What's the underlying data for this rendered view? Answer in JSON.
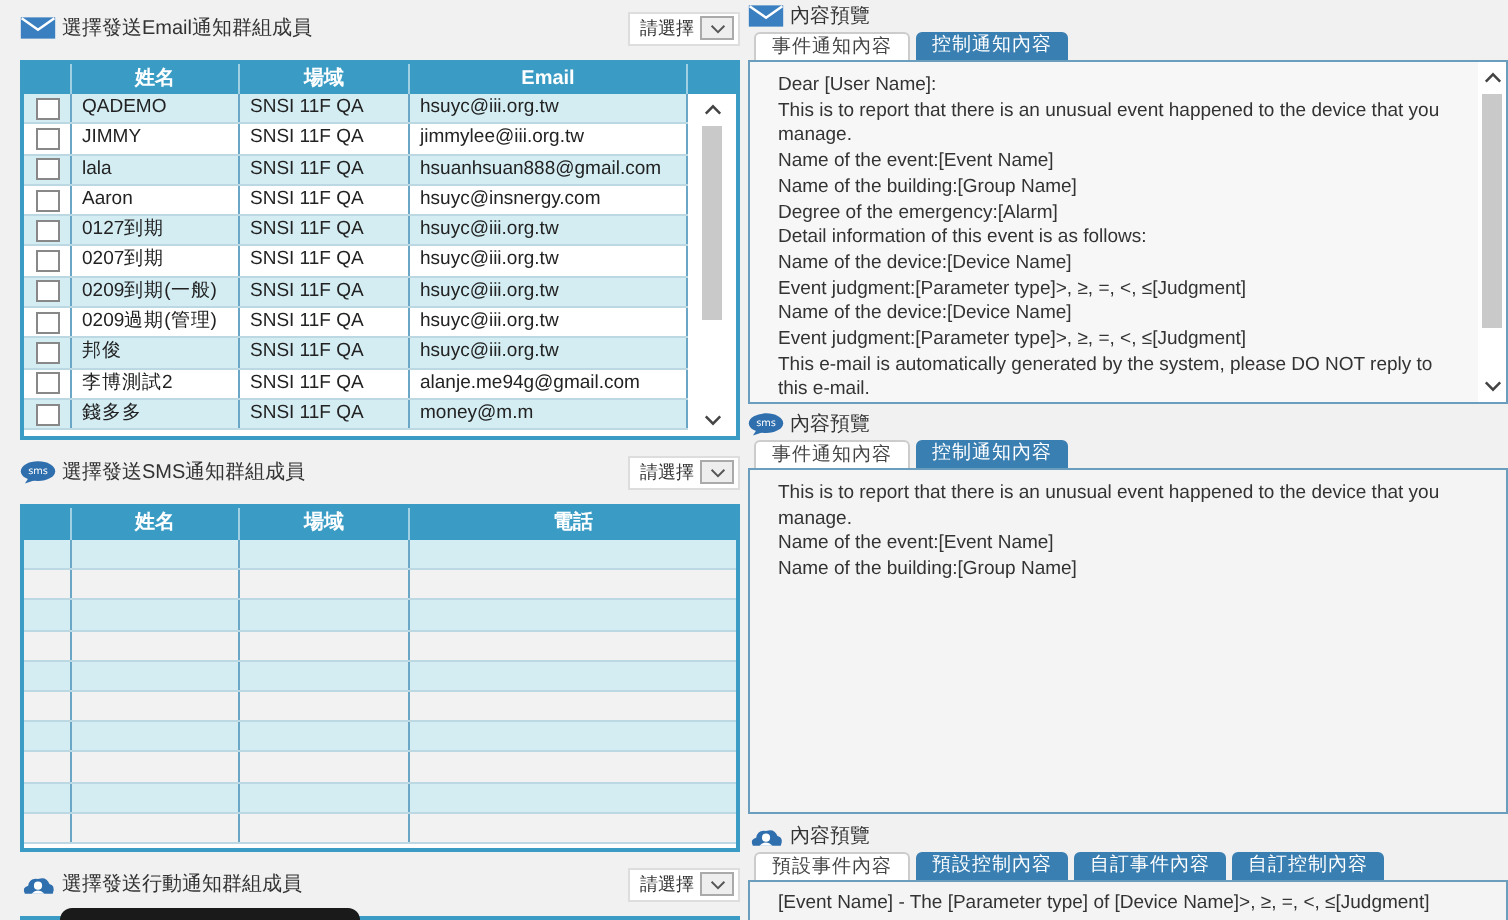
{
  "email_section": {
    "kind": "email",
    "title": "選擇發送Email通知群組成員",
    "select_label": "請選擇",
    "columns": [
      "姓名",
      "場域",
      "Email"
    ],
    "rows": [
      {
        "checked": false,
        "cells": [
          "QADEMO",
          "SNSI 11F QA",
          "hsuyc@iii.org.tw"
        ]
      },
      {
        "checked": false,
        "cells": [
          "JIMMY",
          "SNSI 11F QA",
          "jimmylee@iii.org.tw"
        ]
      },
      {
        "checked": false,
        "cells": [
          "lala",
          "SNSI 11F QA",
          "hsuanhsuan888@gmail.com"
        ]
      },
      {
        "checked": false,
        "cells": [
          "Aaron",
          "SNSI 11F QA",
          "hsuyc@insnergy.com"
        ]
      },
      {
        "checked": false,
        "cells": [
          "0127到期",
          "SNSI 11F QA",
          "hsuyc@iii.org.tw"
        ]
      },
      {
        "checked": false,
        "cells": [
          "0207到期",
          "SNSI 11F QA",
          "hsuyc@iii.org.tw"
        ]
      },
      {
        "checked": false,
        "cells": [
          "0209到期(一般)",
          "SNSI 11F QA",
          "hsuyc@iii.org.tw"
        ]
      },
      {
        "checked": false,
        "cells": [
          "0209過期(管理)",
          "SNSI 11F QA",
          "hsuyc@iii.org.tw"
        ]
      },
      {
        "checked": false,
        "cells": [
          "邦俊",
          "SNSI 11F QA",
          "hsuyc@iii.org.tw"
        ]
      },
      {
        "checked": false,
        "cells": [
          "李博測試2",
          "SNSI 11F QA",
          "alanje.me94g@gmail.com"
        ]
      },
      {
        "checked": false,
        "cells": [
          "錢多多",
          "SNSI 11F QA",
          "money@m.m"
        ]
      }
    ]
  },
  "sms_section": {
    "kind": "sms",
    "title": "選擇發送SMS通知群組成員",
    "select_label": "請選擇",
    "columns": [
      "姓名",
      "場域",
      "電話"
    ]
  },
  "mobile_section": {
    "kind": "mobile",
    "title": "選擇發送行動通知群組成員",
    "select_label": "請選擇"
  },
  "previews": [
    {
      "kind": "email",
      "title": "內容預覽",
      "tabs": [
        {
          "label": "事件通知內容",
          "selected": true
        },
        {
          "label": "控制通知內容",
          "selected": false
        }
      ],
      "lines": [
        "Dear [User Name]:",
        "This is to report that there is an unusual event happened to the device that you manage.",
        "Name of the event:[Event Name]",
        "Name of the building:[Group Name]",
        "Degree of the emergency:[Alarm]",
        "Detail information of this event is as follows:",
        "Name of the device:[Device Name]",
        "Event judgment:[Parameter type]>, ≥, =, <, ≤[Judgment]",
        "Name of the device:[Device Name]",
        "Event judgment:[Parameter type]>, ≥, =, <, ≤[Judgment]",
        "This e-mail is automatically generated by the system, please DO NOT reply to this e-mail."
      ]
    },
    {
      "kind": "sms",
      "title": "內容預覽",
      "tabs": [
        {
          "label": "事件通知內容",
          "selected": true
        },
        {
          "label": "控制通知內容",
          "selected": false
        }
      ],
      "lines": [
        "This is to report that there is an unusual event happened to the device that you manage.",
        "Name of the event:[Event Name]",
        "Name of the building:[Group Name]"
      ]
    },
    {
      "kind": "mobile",
      "title": "內容預覽",
      "tabs": [
        {
          "label": "預設事件內容",
          "selected": true
        },
        {
          "label": "預設控制內容",
          "selected": false
        },
        {
          "label": "自訂事件內容",
          "selected": false
        },
        {
          "label": "自訂控制內容",
          "selected": false
        }
      ],
      "lines": [
        "[Event Name] - The [Parameter type] of [Device Name]>, ≥, =, <, ≤[Judgment]"
      ]
    }
  ]
}
